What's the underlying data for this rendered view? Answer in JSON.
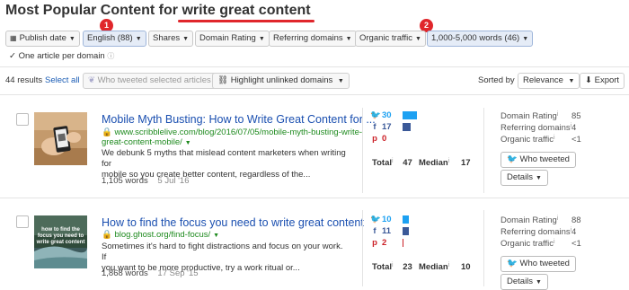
{
  "header": {
    "title_prefix": "Most Popular Content for",
    "query": "write great content",
    "badge1": "1",
    "badge2": "2"
  },
  "filters": [
    {
      "label": "Publish date",
      "icon": "calendar-icon",
      "active": false
    },
    {
      "label": "English (88)",
      "active": true
    },
    {
      "label": "Shares",
      "active": false
    },
    {
      "label": "Domain Rating",
      "active": false
    },
    {
      "label": "Referring domains",
      "active": false
    },
    {
      "label": "Organic traffic",
      "active": false
    },
    {
      "label": "1,000-5,000 words (46)",
      "active": true
    }
  ],
  "one_article_per_domain": {
    "label": "One article per domain",
    "checked": true
  },
  "toolbar": {
    "results": "44 results",
    "select_all": "Select all",
    "who_tweeted_selected": "Who tweeted selected articles",
    "highlight_unlinked": "Highlight unlinked domains",
    "sorted_by_label": "Sorted by",
    "sort_value": "Relevance",
    "export": "Export"
  },
  "articles": [
    {
      "title": "Mobile Myth Busting: How to Write Great Content for ...",
      "url_line1": "www.scribblelive.com/blog/2016/07/05/mobile-myth-busting-write-",
      "url_line2": "great-content-mobile/",
      "desc_line1": "We debunk 5 myths that mislead content marketers when writing for",
      "desc_line2": "mobile so you create better content, regardless of the...",
      "words": "1,105 words",
      "date": "5 Jul '16",
      "twitter": "30",
      "facebook": "17",
      "pinterest": "0",
      "total_label": "Total",
      "total": "47",
      "median_label": "Median",
      "median": "17",
      "domain_rating_label": "Domain Rating",
      "domain_rating": "85",
      "referring_domains_label": "Referring domains",
      "referring_domains": "4",
      "organic_traffic_label": "Organic traffic",
      "organic_traffic": "<1",
      "who_tweeted": "Who tweeted",
      "details": "Details"
    },
    {
      "title": "How to find the focus you need to write great content",
      "url_line1": "blog.ghost.org/find-focus/",
      "desc_line1": "Sometimes it's hard to fight distractions and focus on your work. If",
      "desc_line2": "you want to be more productive, try a work ritual or...",
      "words": "1,868 words",
      "date": "17 Sep '15",
      "twitter": "10",
      "facebook": "11",
      "pinterest": "2",
      "total_label": "Total",
      "total": "23",
      "median_label": "Median",
      "median": "10",
      "domain_rating_label": "Domain Rating",
      "domain_rating": "88",
      "referring_domains_label": "Referring domains",
      "referring_domains": "4",
      "organic_traffic_label": "Organic traffic",
      "organic_traffic": "<1",
      "who_tweeted": "Who tweeted",
      "details": "Details",
      "thumb_text": "how to find the focus you need to write great content"
    }
  ],
  "colors": {
    "accent_red": "#e0262b",
    "link_blue": "#1a4fb0",
    "url_green": "#1e8a1e",
    "twitter": "#1da1f2",
    "facebook": "#3b5998",
    "pinterest": "#cb2027"
  }
}
